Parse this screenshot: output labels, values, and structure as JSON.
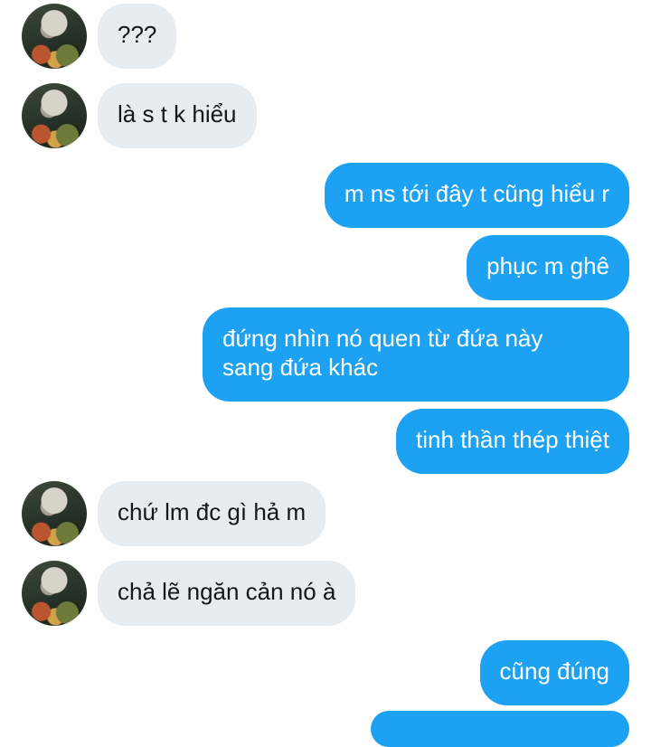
{
  "conversation": {
    "messages": [
      {
        "side": "in",
        "text": "???"
      },
      {
        "side": "in",
        "text": "là s t k hiểu"
      },
      {
        "side": "out",
        "text": "m ns tới đây t cũng hiểu r"
      },
      {
        "side": "out",
        "text": "phục m ghê"
      },
      {
        "side": "out",
        "line1": "đứng nhìn nó quen từ đứa này",
        "line2": "sang đứa khác"
      },
      {
        "side": "out",
        "text": "tinh thần thép thiệt"
      },
      {
        "side": "in",
        "text": "chứ lm đc gì hả m"
      },
      {
        "side": "in",
        "text": "chả lẽ ngăn cản nó à"
      },
      {
        "side": "out",
        "text": "cũng đúng"
      }
    ]
  },
  "colors": {
    "incoming_bubble": "#e6ecf0",
    "outgoing_bubble": "#1da1f2",
    "incoming_text": "#14171a",
    "outgoing_text": "#ffffff"
  }
}
